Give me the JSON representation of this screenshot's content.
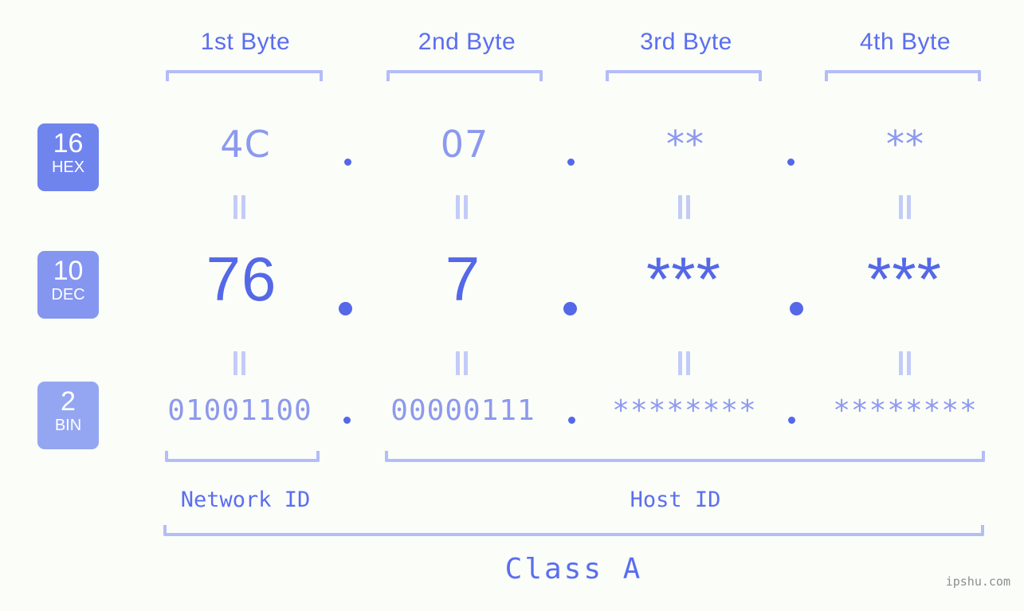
{
  "meta": {
    "watermark": "ipshu.com",
    "background_color": "#fbfdf8",
    "accent_color": "#5468e8",
    "accent_light_color": "#8d99ee",
    "bracket_color": "#b3bdf7"
  },
  "byte_headers": [
    {
      "label": "1st Byte"
    },
    {
      "label": "2nd Byte"
    },
    {
      "label": "3rd Byte"
    },
    {
      "label": "4th Byte"
    }
  ],
  "rows": [
    {
      "badge_number": "16",
      "badge_unit": "HEX",
      "badge_color": "#7084ee",
      "values": [
        "4C",
        "07",
        "**",
        "**"
      ],
      "separator": "."
    },
    {
      "badge_number": "10",
      "badge_unit": "DEC",
      "badge_color": "#8496f0",
      "values": [
        "76",
        "7",
        "***",
        "***"
      ],
      "separator": "."
    },
    {
      "badge_number": "2",
      "badge_unit": "BIN",
      "badge_color": "#94a6f2",
      "values": [
        "01001100",
        "00000111",
        "********",
        "********"
      ],
      "separator": "."
    }
  ],
  "equals_glyphs": {
    "symbol": "=",
    "count_per_row": 4
  },
  "segments": [
    {
      "label": "Network ID"
    },
    {
      "label": "Host ID"
    }
  ],
  "class": {
    "label": "Class A"
  }
}
